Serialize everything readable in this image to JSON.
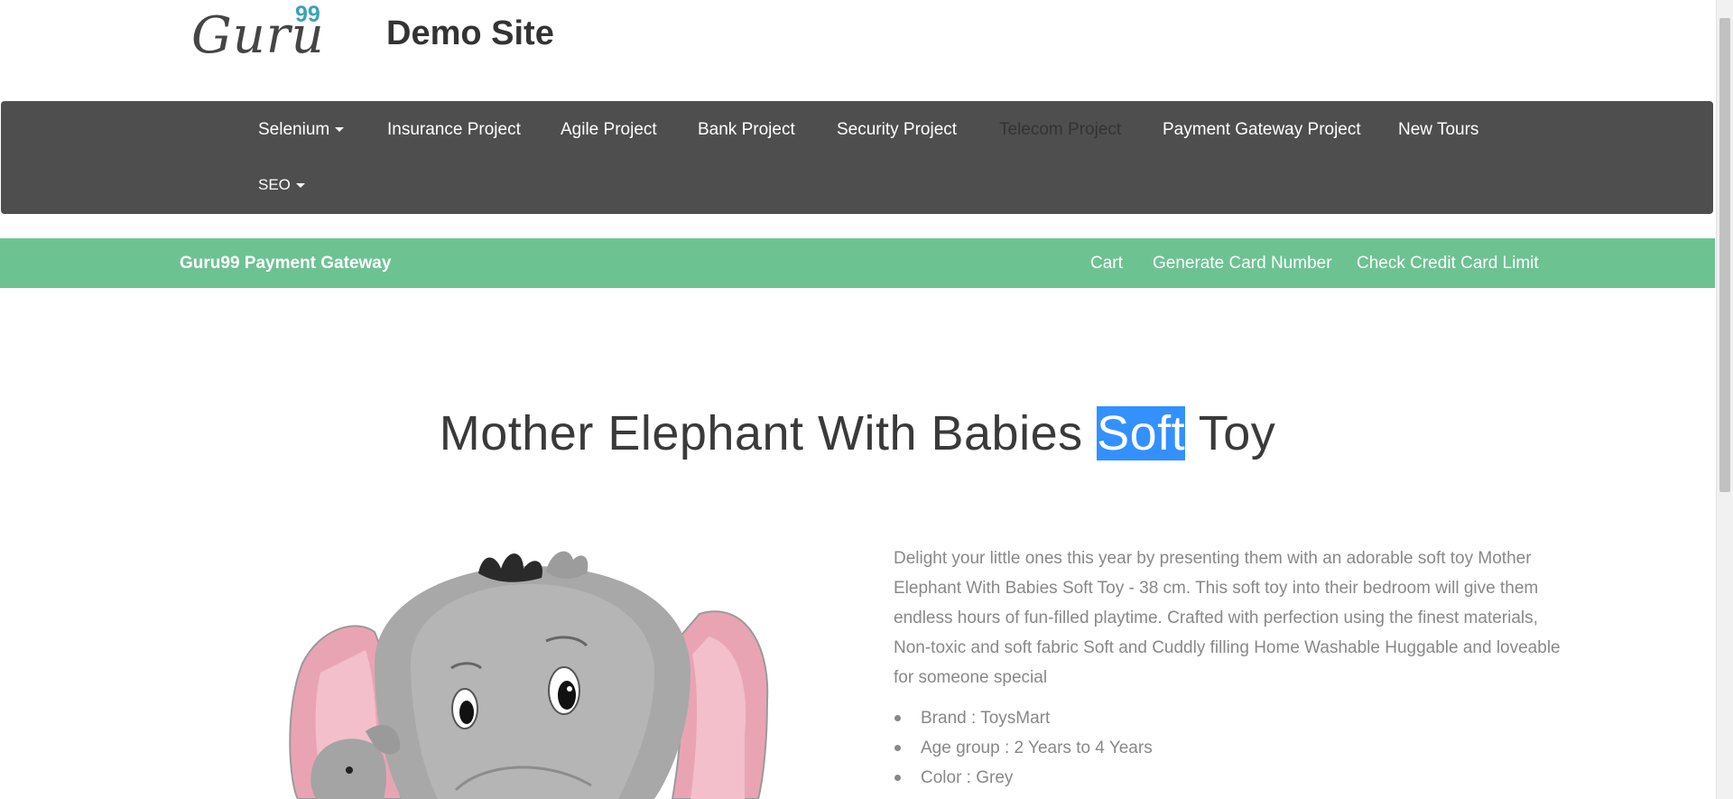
{
  "header": {
    "logo_text": "Guru",
    "logo_sup": "99",
    "site_title": "Demo Site"
  },
  "main_nav": {
    "items": [
      {
        "label": "Selenium",
        "dropdown": true
      },
      {
        "label": "Insurance Project"
      },
      {
        "label": "Agile Project"
      },
      {
        "label": "Bank Project"
      },
      {
        "label": "Security Project"
      },
      {
        "label": "Telecom Project",
        "disabled": true
      },
      {
        "label": "Payment Gateway Project"
      },
      {
        "label": "New Tours"
      },
      {
        "label": "SEO",
        "dropdown": true
      }
    ]
  },
  "sub_nav": {
    "brand": "Guru99 Payment Gateway",
    "links": [
      "Cart",
      "Generate Card Number",
      "Check Credit Card Limit"
    ]
  },
  "product": {
    "title_before": "Mother Elephant With Babies ",
    "title_highlight": "Soft",
    "title_after": " Toy",
    "description": "Delight your little ones this year by presenting them with an adorable soft toy Mother Elephant With Babies Soft Toy - 38 cm. This soft toy into their bedroom will give them endless hours of fun-filled playtime. Crafted with perfection using the finest materials, Non-toxic and soft fabric Soft and Cuddly filling Home Washable Huggable and loveable for someone special",
    "specs": [
      "Brand : ToysMart",
      "Age group : 2 Years to 4 Years",
      "Color : Grey"
    ]
  },
  "colors": {
    "nav_bg": "#4e4e4e",
    "subnav_bg": "#6dc292",
    "logo_accent": "#3aa3b7",
    "selection": "#3390ff"
  }
}
